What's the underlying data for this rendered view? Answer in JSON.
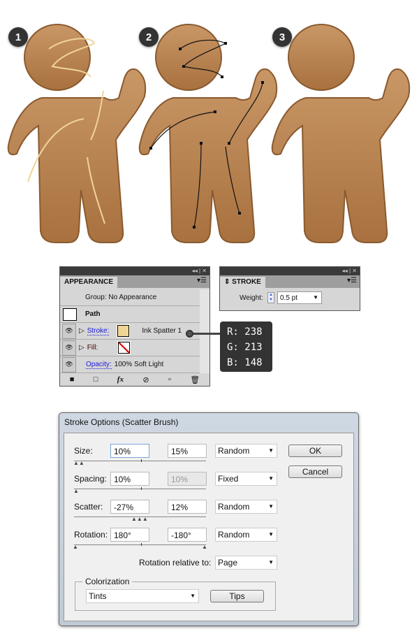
{
  "steps": [
    "1",
    "2",
    "3"
  ],
  "appearance": {
    "title": "APPEARANCE",
    "group": "Group: No Appearance",
    "path": "Path",
    "stroke_label": "Stroke:",
    "stroke_value": "Ink Spatter 1",
    "stroke_color": "#EED594",
    "fill_label": "Fill:",
    "opacity_label": "Opacity:",
    "opacity_value": "100% Soft Light",
    "fx": "fx"
  },
  "stroke_panel": {
    "title": "STROKE",
    "weight_label": "Weight:",
    "weight_value": "0.5 pt"
  },
  "color_tip": {
    "r": "R: 238",
    "g": "G: 213",
    "b": "B: 148"
  },
  "dialog": {
    "title": "Stroke Options (Scatter Brush)",
    "rows": [
      {
        "label": "Size:",
        "min": "10%",
        "max": "15%",
        "mode": "Random"
      },
      {
        "label": "Spacing:",
        "min": "10%",
        "max": "10%",
        "mode": "Fixed"
      },
      {
        "label": "Scatter:",
        "min": "-27%",
        "max": "12%",
        "mode": "Random"
      },
      {
        "label": "Rotation:",
        "min": "180°",
        "max": "-180°",
        "mode": "Random"
      }
    ],
    "rotation_relative_label": "Rotation relative to:",
    "rotation_relative_value": "Page",
    "colorization_label": "Colorization",
    "colorization_value": "Tints",
    "tips": "Tips",
    "ok": "OK",
    "cancel": "Cancel"
  }
}
